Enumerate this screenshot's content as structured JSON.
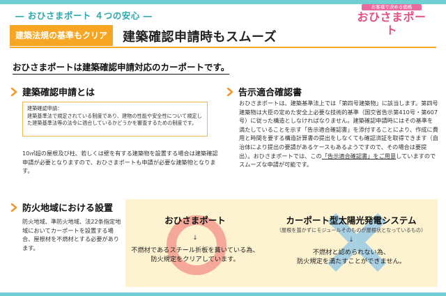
{
  "header": {
    "subtitle": "― おひさまポート ４つの安心 ―",
    "logo_tag": "お客様で決める価格",
    "logo_name": "おひさまポート"
  },
  "title": {
    "tag": "建築法規の基準もクリア",
    "main": "建築確認申請時もスムーズ"
  },
  "lead": "おひさまポートは建築確認申請対応のカーポートです。",
  "sections": {
    "kakunin": {
      "title": "建築確認申請とは",
      "note_label": "建築確認申請：",
      "note_text": "建築基準法で規定されている制度であり、建物の性能や安全性について規定した建築基準法等の法令に適合しているかどうかを審査するための制度です。",
      "body": "10㎡超の屋根及び柱、若しくは壁を有する建築物を設置する場合は建築確認申請が必要となりますので、おひさまポートも申請が必要な建築物となります。"
    },
    "kokuji": {
      "title": "告示適合確認書",
      "body_1": "おひさまポートは、建築基準法上では「第四号建築物」に該当します。第四号建築物は大臣の定めた安全上必要な技術的基準（国交省告示第410号・第607号）に従った構造としなければなりません。建築確認申請時にはその基準を満たしていることを示す「告示適合確認書」を添付することにより、作成に費用と時間を要する構造計算書の提出をしなくても確認済証を取得できます（自治体により提出の要請があるケースもあるようですので、その場合は要提出）。おひさまポートでは、この",
      "body_link": "「告示適合確認書」をご用意",
      "body_2": "していますのでスムーズな申請が可能です。"
    },
    "bouka": {
      "title": "防火地域における設置",
      "body": "防火地域、準防火地域、法22条指定地域においてカーポートを設置する場合、屋根材を不燃材とする必要があります。"
    }
  },
  "compare": {
    "left": {
      "title": "おひさまポート",
      "arrow": "↓",
      "line1": "不燃材であるスチール折板を葺いている為、",
      "line2": "防火規定をクリアしています。",
      "mark": "circle",
      "mark_color": "#f39a8e"
    },
    "right": {
      "title": "カーポート型太陽光発電システム",
      "sub": "（屋根を葺かずにモジュールそのものが屋根状となっているもの）",
      "arrow": "↓",
      "line1": "不燃材と認められない為、",
      "line2": "防火規定を満たすことができません。",
      "mark": "cross",
      "mark_color": "#9ecde6"
    }
  },
  "colors": {
    "accent_orange": "#f6a623",
    "accent_teal": "#6fcfd3",
    "panel_bg": "#fdf3d1"
  }
}
